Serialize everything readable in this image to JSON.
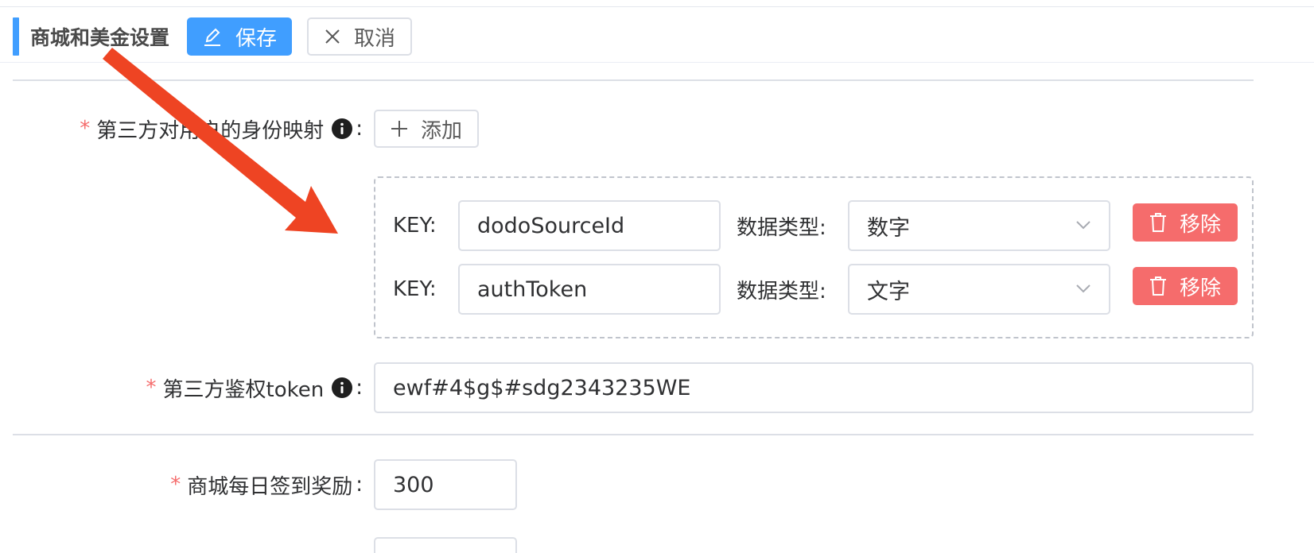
{
  "header": {
    "title": "商城和美金设置",
    "save_label": "保存",
    "cancel_label": "取消"
  },
  "form": {
    "identity_mapping": {
      "label": "第三方对用户的身份映射",
      "colon": ":",
      "add_label": "添加",
      "key_label": "KEY:",
      "type_label": "数据类型:",
      "remove_label": "移除",
      "rows": [
        {
          "key": "dodoSourceId",
          "type": "数字"
        },
        {
          "key": "authToken",
          "type": "文字"
        }
      ]
    },
    "auth_token": {
      "label": "第三方鉴权token",
      "colon": ":",
      "value": "ewf#4$g$#sdg2343235WE"
    },
    "daily_checkin": {
      "label": "商城每日签到奖励",
      "colon": ":",
      "value": "300"
    }
  },
  "colors": {
    "primary": "#409eff",
    "danger": "#f56c6c",
    "annotation_arrow": "#ee4423"
  }
}
